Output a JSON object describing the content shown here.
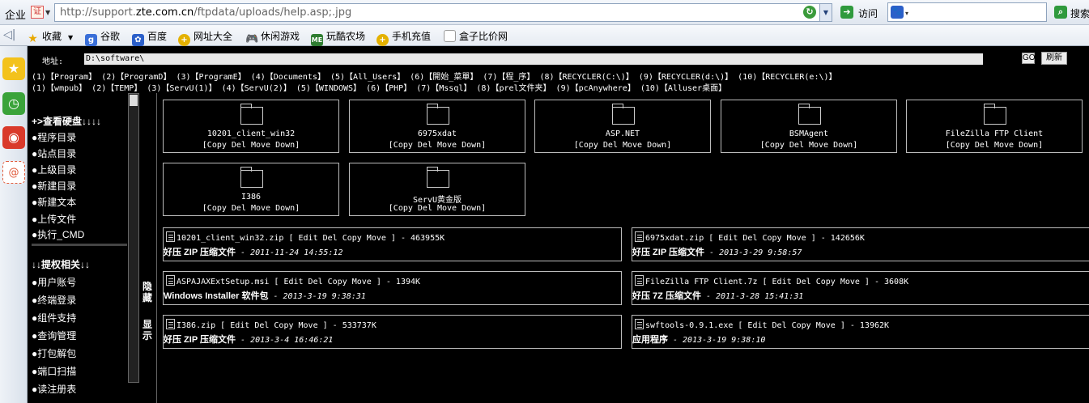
{
  "browser": {
    "mode_label": "企业",
    "url_prefix": "http://support.",
    "url_domain": "zte.com.cn",
    "url_suffix": "/ftpdata/uploads/help.asp;.jpg",
    "go_label": "访问",
    "search_label": "搜索",
    "search_value": ""
  },
  "bookmarks": [
    {
      "label": "收藏"
    },
    {
      "label": "谷歌"
    },
    {
      "label": "百度"
    },
    {
      "label": "网址大全"
    },
    {
      "label": "休闲游戏"
    },
    {
      "label": "玩酷农场"
    },
    {
      "label": "手机充值"
    },
    {
      "label": "盒子比价网"
    }
  ],
  "page": {
    "address_label": "地址:",
    "address_value": "D:\\software\\",
    "go_btn": "GO",
    "refresh_btn": "刷新",
    "quick_row1": "(1)【Program】 (2)【ProgramD】 (3)【ProgramE】 (4)【Documents】 (5)【All_Users】 (6)【開始_菜單】 (7)【程_序】 (8)【RECYCLER(C:\\)】 (9)【RECYCLER(d:\\)】 (10)【RECYCLER(e:\\)】",
    "quick_row2": "(1)【wmpub】    (2)【TEMP】     (3)【ServU(1)】 (4)【ServU(2)】  (5)【WINDOWS】    (6)【PHP】        (7)【Mssql】 (8)【prel文件夹】     (9)【pcAnywhere】    (10)【Alluser桌面】",
    "menu_header1": "+>查看硬盘↓↓↓↓",
    "menu_items1": [
      "●程序目录",
      "●站点目录",
      "●上级目录",
      "●新建目录",
      "●新建文本",
      "●上传文件",
      "●执行_CMD"
    ],
    "menu_header2": "↓↓提权相关↓↓",
    "menu_items2": [
      "●用户账号",
      "●终端登录",
      "●组件支持",
      "●查询管理",
      "●打包解包",
      "●端口扫描",
      "●读注册表"
    ],
    "hide_label": "隐藏",
    "show_label": "显示"
  },
  "folders": [
    {
      "name": "10201_client_win32",
      "ops": "[Copy Del Move Down]"
    },
    {
      "name": "6975xdat",
      "ops": "[Copy Del Move Down]"
    },
    {
      "name": "ASP.NET",
      "ops": "[Copy Del Move Down]"
    },
    {
      "name": "BSMAgent",
      "ops": "[Copy Del Move Down]"
    },
    {
      "name": "FileZilla FTP Client",
      "ops": "[Copy Del Move Down]"
    },
    {
      "name": "I386",
      "ops": "[Copy Del Move Down]"
    },
    {
      "name": "ServU黄金版",
      "ops": "[Copy Del Move Down]"
    }
  ],
  "files": [
    {
      "title": "10201_client_win32.zip [ Edit Del Copy Move ] - 463955K",
      "type": "好压 ZIP 压缩文件",
      "date": "- 2011-11-24 14:55:12"
    },
    {
      "title": "6975xdat.zip [ Edit Del Copy Move ] - 142656K",
      "type": "好压 ZIP 压缩文件",
      "date": "- 2013-3-29 9:58:57"
    },
    {
      "title": "ASPAJAXExtSetup.msi [ Edit Del Copy Move ] - 1394K",
      "type": "Windows Installer 软件包",
      "date": "- 2013-3-19 9:38:31"
    },
    {
      "title": "FileZilla FTP Client.7z [ Edit Del Copy Move ] - 3608K",
      "type": "好压 7Z 压缩文件",
      "date": "- 2011-3-28 15:41:31"
    },
    {
      "title": "I386.zip [ Edit Del Copy Move ] - 533737K",
      "type": "好压 ZIP 压缩文件",
      "date": "- 2013-3-4 16:46:21"
    },
    {
      "title": "swftools-0.9.1.exe [ Edit Del Copy Move ] - 13962K",
      "type": "应用程序",
      "date": "- 2013-3-19 9:38:10"
    }
  ]
}
